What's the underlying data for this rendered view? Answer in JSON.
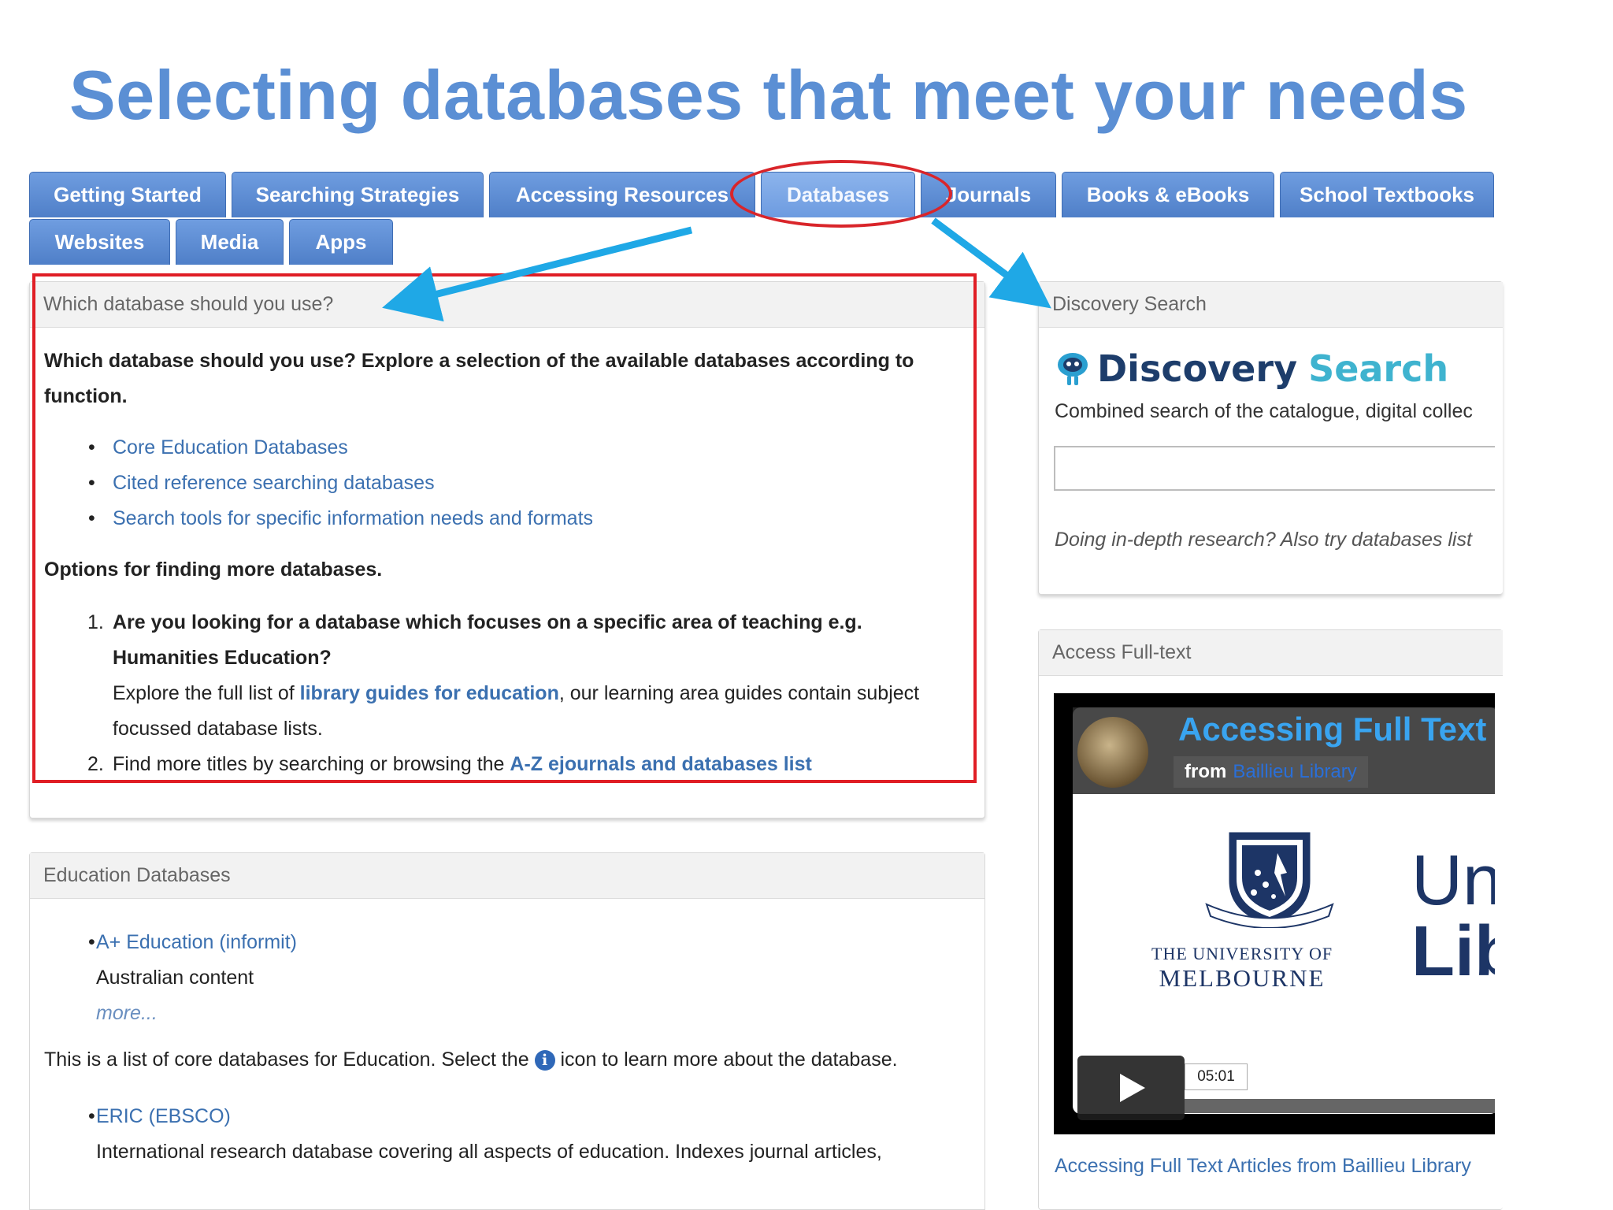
{
  "slide_title": "Selecting databases that meet your needs",
  "tabs": [
    {
      "label": "Getting Started"
    },
    {
      "label": "Searching Strategies"
    },
    {
      "label": "Accessing Resources"
    },
    {
      "label": "Databases"
    },
    {
      "label": "Journals"
    },
    {
      "label": "Books & eBooks"
    },
    {
      "label": "School Textbooks"
    },
    {
      "label": "Websites"
    },
    {
      "label": "Media"
    },
    {
      "label": "Apps"
    }
  ],
  "which_db_panel": {
    "header": "Which database should you use?",
    "intro_line1": "Which database should you use? Explore a selection of the available databases according to",
    "intro_line2": "function.",
    "links": [
      "Core Education Databases",
      "Cited reference searching databases",
      "Search tools for specific information needs and formats"
    ],
    "options_heading": "Options for finding more databases.",
    "item1_num": "1.",
    "item1_q_line1": "Are you looking for a database which focuses on a specific area of teaching e.g.",
    "item1_q_line2": "Humanities Education?",
    "item1_explore_prefix": "Explore the full list of ",
    "item1_explore_link": "library guides for education",
    "item1_explore_suffix": ", our learning area guides contain subject",
    "item1_line4": "focussed database lists.",
    "item2_num": "2.",
    "item2_prefix": "Find more titles by searching or browsing the ",
    "item2_link": "A-Z ejournals and databases list"
  },
  "education_panel": {
    "header": "Education Databases",
    "db1_link": "A+ Education (informit)",
    "db1_desc": "Australian content",
    "db1_more": "more...",
    "note_prefix": "This is a list of core databases for Education. Select the ",
    "note_icon": "i",
    "note_suffix": " icon to learn more about the database.",
    "db2_link": "ERIC (EBSCO)",
    "db2_desc": "International research database covering all aspects of education. Indexes journal articles,"
  },
  "discovery_panel": {
    "header": "Discovery Search",
    "logo_word1": "Discovery",
    "logo_word2": "Search",
    "description": "Combined search of the catalogue, digital collec",
    "input_value": "",
    "hint": "Doing in-depth research? Also try databases list"
  },
  "fulltext_panel": {
    "header": "Access Full-text",
    "video_title": "Accessing Full Text",
    "video_from": "from",
    "video_channel": "Baillieu Library",
    "crest_line1": "THE UNIVERSITY OF",
    "crest_line2": "MELBOURNE",
    "big_text1": "Uni",
    "big_text2": "Lib",
    "duration": "05:01",
    "caption_prefix": "Accessing Full Text Articles from ",
    "caption_link": "Baillieu Library"
  },
  "colors": {
    "title": "#5b8fd4",
    "tab": "#4f7fc8",
    "link": "#3b70b0",
    "annotation_red": "#e01e25",
    "annotation_arrow": "#1fa8e6",
    "discovery_dark": "#1d3d6b",
    "discovery_light": "#3fb3cf"
  },
  "icons": [
    "info-icon",
    "discovery-logo-icon",
    "play-icon",
    "arrow-annotation"
  ]
}
